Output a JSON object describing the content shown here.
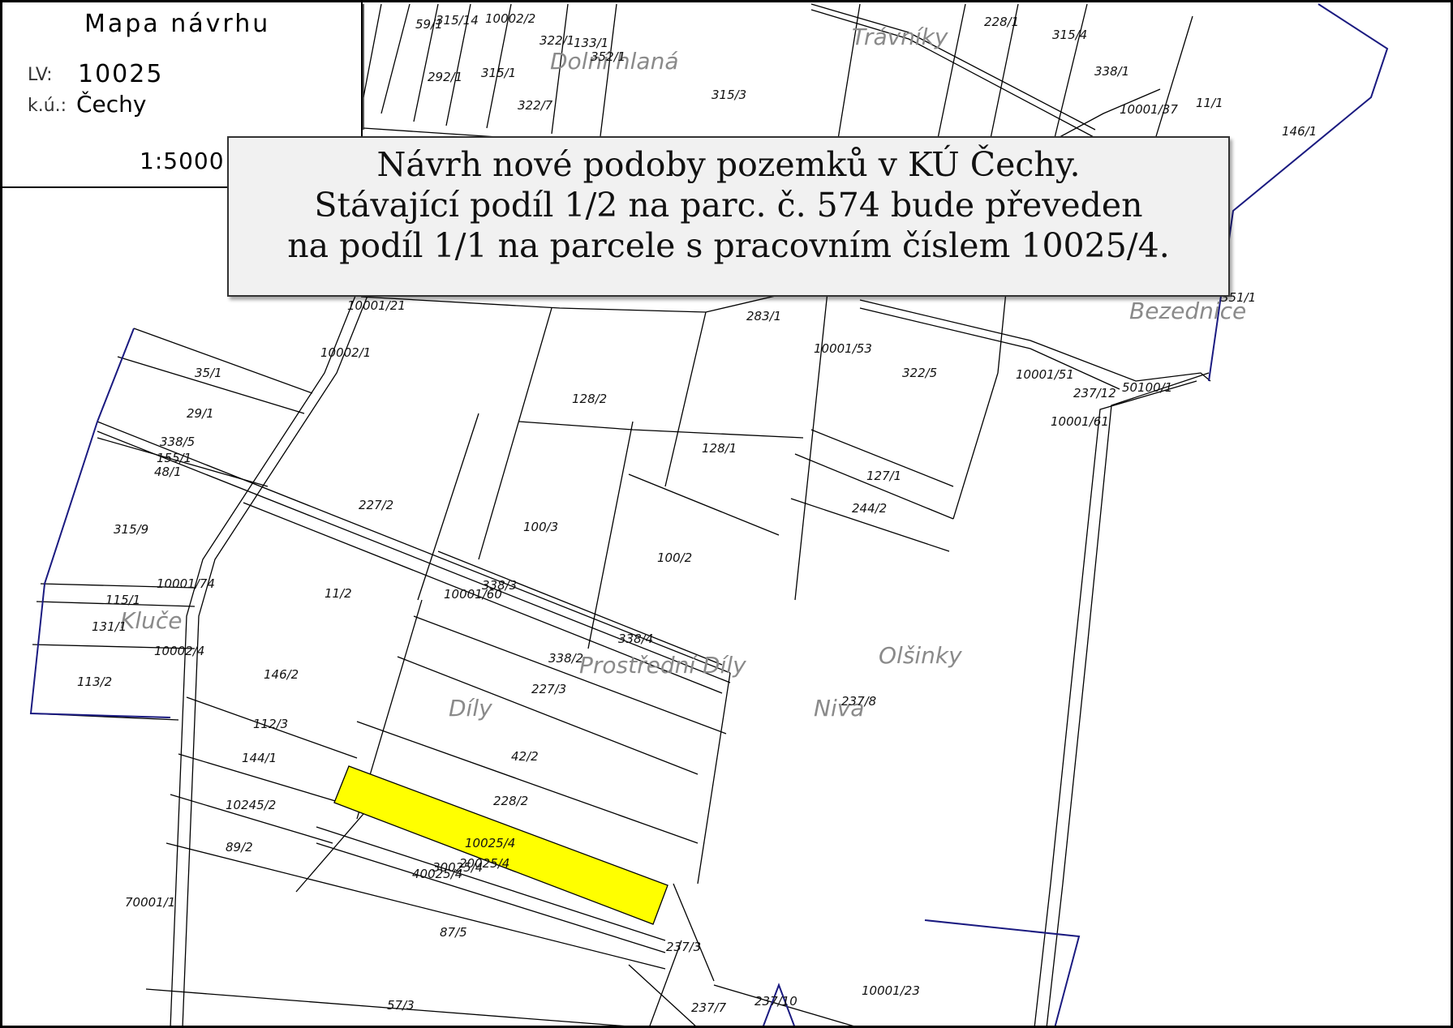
{
  "legend": {
    "title": "Mapa návrhu",
    "lv_label": "LV:",
    "lv_value": "10025",
    "ku_label": "k.ú.:",
    "ku_value": "Čechy",
    "scale": "1:5000"
  },
  "notice": {
    "line1": "Návrh nové podoby pozemků v KÚ Čechy.",
    "line2": "Stávající podíl 1/2 na parc. č. 574 bude převeden",
    "line3": "na podíl 1/1 na parcele s pracovním číslem 10025/4."
  },
  "highlight_color": "#ffff00",
  "boundary_color": "#1a1a80",
  "locality_names": {
    "travniky": "Trávníky",
    "dolni": "Dolní hlaná",
    "bezednice": "Bezednice",
    "kluce": "Kluče",
    "prostredni": "Prostřední Díly",
    "dily": "Díly",
    "olsinky": "Olšinky",
    "niva": "Niva"
  },
  "parcels": {
    "p59": "59/1",
    "p315_14": "315/14",
    "p10002_2": "10002/2",
    "p322_1": "322/1",
    "p133_1": "133/1",
    "p352_1": "352/1",
    "p292_1": "292/1",
    "p315_1": "315/1",
    "p322_7": "322/7",
    "p315_3": "315/3",
    "p228_1": "228/1",
    "p315_4": "315/4",
    "p338_1": "338/1",
    "p10001_37": "10001/37",
    "p11_1": "11/1",
    "p146_1": "146/1",
    "p10001_21": "10001/21",
    "p10002_1": "10002/1",
    "p283_1": "283/1",
    "p10001_53": "10001/53",
    "p322_5": "322/5",
    "p351_1": "351/1",
    "p10001_51": "10001/51",
    "p237_12": "237/12",
    "p50100_1": "50100/1",
    "p10001_61": "10001/61",
    "p35_1": "35/1",
    "p29_1": "29/1",
    "p128_2": "128/2",
    "p128_1": "128/1",
    "p338_5": "338/5",
    "p155_1": "155/1",
    "p48_1": "48/1",
    "p127_1": "127/1",
    "p227_2": "227/2",
    "p244_2": "244/2",
    "p315_9": "315/9",
    "p100_3": "100/3",
    "p100_2": "100/2",
    "p115_1": "115/1",
    "p10001_74": "10001/74",
    "p11_2": "11/2",
    "p10001_60": "10001/60",
    "p338_3": "338/3",
    "p131_1": "131/1",
    "p338_4": "338/4",
    "p10002_4": "10002/4",
    "p146_2": "146/2",
    "p338_2": "338/2",
    "p113_2": "113/2",
    "p227_3": "227/3",
    "p112_3": "112/3",
    "p237_8": "237/8",
    "p144_1": "144/1",
    "p42_2": "42/2",
    "p10245_2": "10245/2",
    "p228_2": "228/2",
    "p10025_4": "10025/4",
    "p89_2": "89/2",
    "p30025_4": "30025/4",
    "p20025_4": "20025/4",
    "p40025_4": "40025/4",
    "p70001_1": "70001/1",
    "p87_5": "87/5",
    "p237_3": "237/3",
    "p10001_23": "10001/23",
    "p57_3": "57/3",
    "p237_7": "237/7",
    "p237_10": "237/10"
  }
}
